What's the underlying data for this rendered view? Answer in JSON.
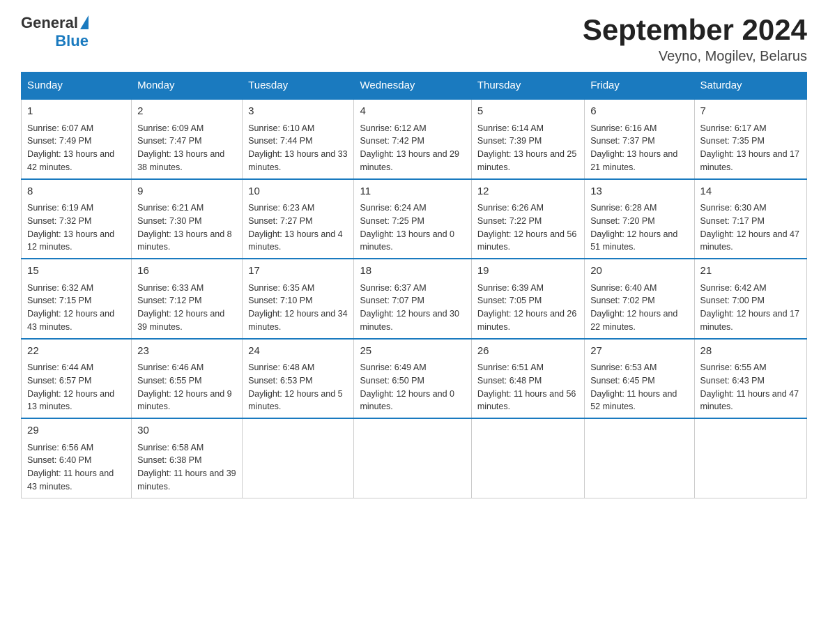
{
  "logo": {
    "text_general": "General",
    "text_blue": "Blue"
  },
  "title": "September 2024",
  "subtitle": "Veyno, Mogilev, Belarus",
  "weekdays": [
    "Sunday",
    "Monday",
    "Tuesday",
    "Wednesday",
    "Thursday",
    "Friday",
    "Saturday"
  ],
  "weeks": [
    [
      {
        "day": "1",
        "sunrise": "6:07 AM",
        "sunset": "7:49 PM",
        "daylight": "13 hours and 42 minutes."
      },
      {
        "day": "2",
        "sunrise": "6:09 AM",
        "sunset": "7:47 PM",
        "daylight": "13 hours and 38 minutes."
      },
      {
        "day": "3",
        "sunrise": "6:10 AM",
        "sunset": "7:44 PM",
        "daylight": "13 hours and 33 minutes."
      },
      {
        "day": "4",
        "sunrise": "6:12 AM",
        "sunset": "7:42 PM",
        "daylight": "13 hours and 29 minutes."
      },
      {
        "day": "5",
        "sunrise": "6:14 AM",
        "sunset": "7:39 PM",
        "daylight": "13 hours and 25 minutes."
      },
      {
        "day": "6",
        "sunrise": "6:16 AM",
        "sunset": "7:37 PM",
        "daylight": "13 hours and 21 minutes."
      },
      {
        "day": "7",
        "sunrise": "6:17 AM",
        "sunset": "7:35 PM",
        "daylight": "13 hours and 17 minutes."
      }
    ],
    [
      {
        "day": "8",
        "sunrise": "6:19 AM",
        "sunset": "7:32 PM",
        "daylight": "13 hours and 12 minutes."
      },
      {
        "day": "9",
        "sunrise": "6:21 AM",
        "sunset": "7:30 PM",
        "daylight": "13 hours and 8 minutes."
      },
      {
        "day": "10",
        "sunrise": "6:23 AM",
        "sunset": "7:27 PM",
        "daylight": "13 hours and 4 minutes."
      },
      {
        "day": "11",
        "sunrise": "6:24 AM",
        "sunset": "7:25 PM",
        "daylight": "13 hours and 0 minutes."
      },
      {
        "day": "12",
        "sunrise": "6:26 AM",
        "sunset": "7:22 PM",
        "daylight": "12 hours and 56 minutes."
      },
      {
        "day": "13",
        "sunrise": "6:28 AM",
        "sunset": "7:20 PM",
        "daylight": "12 hours and 51 minutes."
      },
      {
        "day": "14",
        "sunrise": "6:30 AM",
        "sunset": "7:17 PM",
        "daylight": "12 hours and 47 minutes."
      }
    ],
    [
      {
        "day": "15",
        "sunrise": "6:32 AM",
        "sunset": "7:15 PM",
        "daylight": "12 hours and 43 minutes."
      },
      {
        "day": "16",
        "sunrise": "6:33 AM",
        "sunset": "7:12 PM",
        "daylight": "12 hours and 39 minutes."
      },
      {
        "day": "17",
        "sunrise": "6:35 AM",
        "sunset": "7:10 PM",
        "daylight": "12 hours and 34 minutes."
      },
      {
        "day": "18",
        "sunrise": "6:37 AM",
        "sunset": "7:07 PM",
        "daylight": "12 hours and 30 minutes."
      },
      {
        "day": "19",
        "sunrise": "6:39 AM",
        "sunset": "7:05 PM",
        "daylight": "12 hours and 26 minutes."
      },
      {
        "day": "20",
        "sunrise": "6:40 AM",
        "sunset": "7:02 PM",
        "daylight": "12 hours and 22 minutes."
      },
      {
        "day": "21",
        "sunrise": "6:42 AM",
        "sunset": "7:00 PM",
        "daylight": "12 hours and 17 minutes."
      }
    ],
    [
      {
        "day": "22",
        "sunrise": "6:44 AM",
        "sunset": "6:57 PM",
        "daylight": "12 hours and 13 minutes."
      },
      {
        "day": "23",
        "sunrise": "6:46 AM",
        "sunset": "6:55 PM",
        "daylight": "12 hours and 9 minutes."
      },
      {
        "day": "24",
        "sunrise": "6:48 AM",
        "sunset": "6:53 PM",
        "daylight": "12 hours and 5 minutes."
      },
      {
        "day": "25",
        "sunrise": "6:49 AM",
        "sunset": "6:50 PM",
        "daylight": "12 hours and 0 minutes."
      },
      {
        "day": "26",
        "sunrise": "6:51 AM",
        "sunset": "6:48 PM",
        "daylight": "11 hours and 56 minutes."
      },
      {
        "day": "27",
        "sunrise": "6:53 AM",
        "sunset": "6:45 PM",
        "daylight": "11 hours and 52 minutes."
      },
      {
        "day": "28",
        "sunrise": "6:55 AM",
        "sunset": "6:43 PM",
        "daylight": "11 hours and 47 minutes."
      }
    ],
    [
      {
        "day": "29",
        "sunrise": "6:56 AM",
        "sunset": "6:40 PM",
        "daylight": "11 hours and 43 minutes."
      },
      {
        "day": "30",
        "sunrise": "6:58 AM",
        "sunset": "6:38 PM",
        "daylight": "11 hours and 39 minutes."
      },
      null,
      null,
      null,
      null,
      null
    ]
  ]
}
